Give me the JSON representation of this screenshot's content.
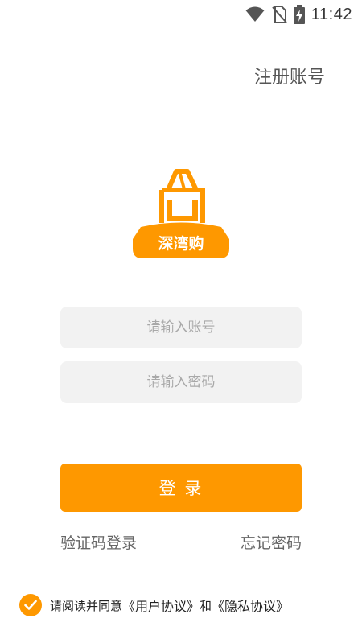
{
  "status_bar": {
    "time": "11:42",
    "icons": [
      "wifi-icon",
      "no-sim-icon",
      "battery-charging-icon"
    ]
  },
  "header": {
    "register_label": "注册账号"
  },
  "logo": {
    "text": "深湾购",
    "color": "#fe9800"
  },
  "form": {
    "account_placeholder": "请输入账号",
    "password_placeholder": "请输入密码",
    "login_label": "登 录"
  },
  "links": {
    "sms_login": "验证码登录",
    "forgot_password": "忘记密码"
  },
  "agreement": {
    "checked": true,
    "prefix": "请阅读并同意",
    "user_agreement": "《用户协议》",
    "and": "和",
    "privacy_policy": "《隐私协议》"
  },
  "colors": {
    "accent": "#fe9800",
    "input_bg": "#f2f2f2"
  }
}
